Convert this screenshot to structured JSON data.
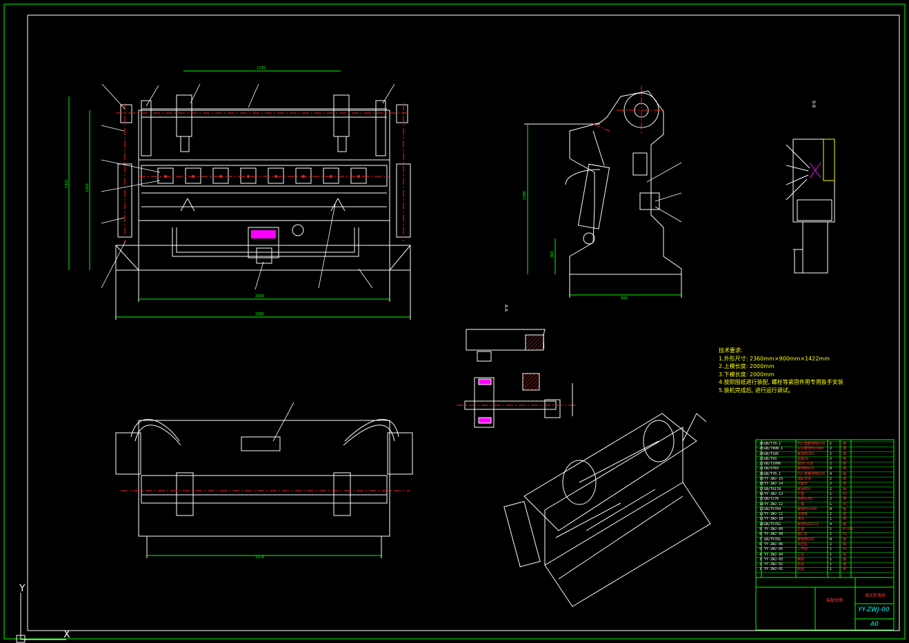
{
  "tech_requirements": {
    "heading": "技术要求:",
    "lines": [
      "1.外形尺寸: 2360mm×900mm×1422mm",
      "2.上模长度: 2000mm",
      "3.下模长度: 2000mm",
      "4.按照图纸进行装配, 螺栓等紧固件用专用扳手安装",
      "5.装机完成后, 进行运行调试。"
    ]
  },
  "title_block": {
    "drawing_name": "液压折弯机",
    "drawing_code": "YY-ZWJ-00",
    "sheet_size": "A0",
    "assembly_label": "装配总图"
  },
  "bom": [
    {
      "no": "26",
      "code": "GB/T70.1",
      "name": "内六角螺栓M8X30",
      "qty": "1",
      "mat": "钢"
    },
    {
      "no": "25",
      "code": "GB/T898.1",
      "name": "双头螺栓M10X40",
      "qty": "2",
      "mat": "钢"
    },
    {
      "no": "24",
      "code": "GB/T185",
      "name": "螺母M10X1",
      "qty": "2",
      "mat": "钢"
    },
    {
      "no": "23",
      "code": "GB/T93",
      "name": "垫圈10",
      "qty": "2",
      "mat": "钢"
    },
    {
      "no": "22",
      "code": "GB/T1096",
      "name": "键8X7X28",
      "qty": "2",
      "mat": "钢"
    },
    {
      "no": "21",
      "code": "GB/5783",
      "name": "螺栓M8X25",
      "qty": "8",
      "mat": "钢"
    },
    {
      "no": "20",
      "code": "GB/T70.1",
      "name": "内六角螺栓M6X20",
      "qty": "4",
      "mat": "钢"
    },
    {
      "no": "19",
      "code": "YY-ZWJ-15",
      "name": "油缸支架",
      "qty": "2",
      "mat": "钢"
    },
    {
      "no": "18",
      "code": "YY-ZWJ-14",
      "name": "活塞杆",
      "qty": "2",
      "mat": "钢"
    },
    {
      "no": "17",
      "code": "GB/T6170",
      "name": "螺母M16",
      "qty": "2",
      "mat": "钢"
    },
    {
      "no": "16",
      "code": "YY-ZWJ-13",
      "name": "下模",
      "qty": "1",
      "mat": "45"
    },
    {
      "no": "15",
      "code": "GB/T276",
      "name": "轴承6208",
      "qty": "2",
      "mat": "钢"
    },
    {
      "no": "14",
      "code": "YY-ZWJ-12",
      "name": "上模",
      "qty": "1",
      "mat": "45"
    },
    {
      "no": "13",
      "code": "GB/T5784",
      "name": "螺栓M10X80",
      "qty": "8",
      "mat": "钢"
    },
    {
      "no": "12",
      "code": "YY-ZWJ-11",
      "name": "连接板",
      "qty": "2",
      "mat": "钢"
    },
    {
      "no": "11",
      "code": "YY-ZWJ-10",
      "name": "滑块",
      "qty": "1",
      "mat": "钢"
    },
    {
      "no": "10",
      "code": "GB/T5782",
      "name": "螺栓M20X110",
      "qty": "4",
      "mat": "钢"
    },
    {
      "no": "9",
      "code": "YY-ZWJ-09",
      "name": "主轴",
      "qty": "1",
      "mat": "HT200"
    },
    {
      "no": "8",
      "code": "YY-ZWJ-08",
      "name": "偏心轮",
      "qty": "2",
      "mat": "45"
    },
    {
      "no": "7",
      "code": "GB/T5781",
      "name": "螺栓M8X45",
      "qty": "8",
      "mat": "钢"
    },
    {
      "no": "6",
      "code": "YY-ZWJ-06",
      "name": "液压缸",
      "qty": "2",
      "mat": "钢"
    },
    {
      "no": "5",
      "code": "YY-ZWJ-05",
      "name": "工作台",
      "qty": "1",
      "mat": "45"
    },
    {
      "no": "4",
      "code": "YY-ZWJ-04",
      "name": "立柱",
      "qty": "2",
      "mat": "钢"
    },
    {
      "no": "3",
      "code": "YY-ZWJ-03",
      "name": "横梁",
      "qty": "1",
      "mat": "钢"
    },
    {
      "no": "2",
      "code": "YY-ZWJ-02",
      "name": "机架",
      "qty": "1",
      "mat": "钢"
    },
    {
      "no": "1",
      "code": "YY-ZWJ-01",
      "name": "底座",
      "qty": "1",
      "mat": "钢"
    }
  ],
  "dimensions": {
    "front_top": "1256",
    "front_bottom_inner": "2000",
    "front_bottom_outer": "2360",
    "front_height_outer": "1422",
    "front_height_inner": "1050",
    "side_height": "1380",
    "side_width": "900",
    "side_foot": "360",
    "top_view_width": "1978"
  },
  "section_labels": {
    "a": "A-A",
    "b": "B-B"
  },
  "axis": {
    "y": "Y",
    "x": "X"
  }
}
